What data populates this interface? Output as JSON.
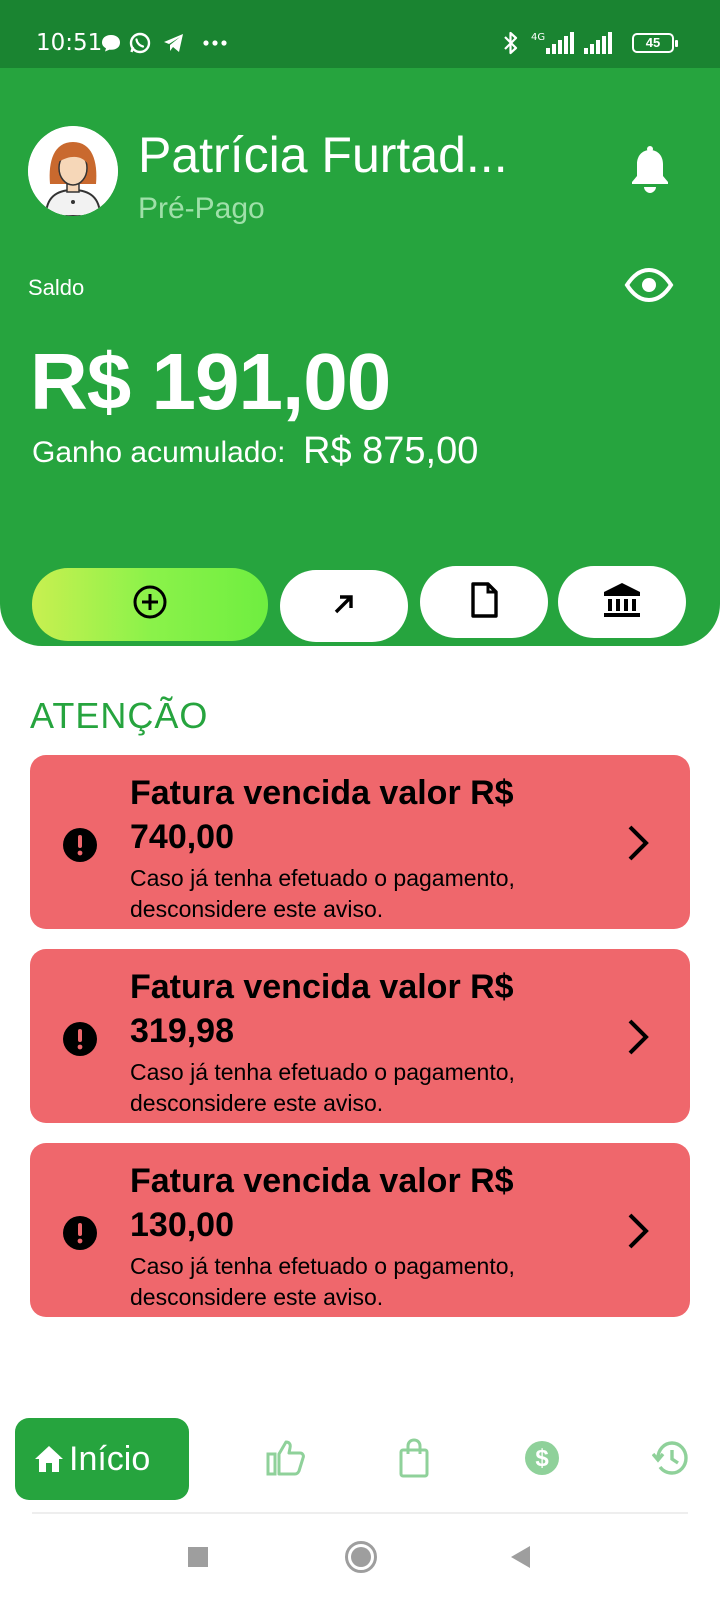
{
  "status_bar": {
    "time": "10:51",
    "network": "4G",
    "battery": "45"
  },
  "profile": {
    "name": "Patrícia Furtad...",
    "plan": "Pré-Pago"
  },
  "balance": {
    "label": "Saldo",
    "value": "R$ 191,00",
    "accumulated_label": "Ganho acumulado:",
    "accumulated_value": "R$ 875,00"
  },
  "actions": [
    {
      "label": "Depositar",
      "icon": "plus-circle-icon"
    },
    {
      "label": "Sacar",
      "icon": "arrow-up-right-icon"
    },
    {
      "label": "Extrato",
      "icon": "document-icon"
    },
    {
      "label": "Banco",
      "icon": "bank-icon"
    }
  ],
  "attention": {
    "title": "ATENÇÃO",
    "alerts": [
      {
        "title": "Fatura vencida valor R$ 740,00",
        "message": "Caso já tenha efetuado o pagamento, desconsidere este aviso."
      },
      {
        "title": "Fatura vencida valor R$ 319,98",
        "message": "Caso já tenha efetuado o pagamento, desconsidere este aviso."
      },
      {
        "title": "Fatura vencida valor R$ 130,00",
        "message": "Caso já tenha efetuado o pagamento, desconsidere este aviso."
      }
    ]
  },
  "bottom_nav": {
    "home_label": "Início",
    "items": [
      "home-icon",
      "thumbs-up-icon",
      "shopping-bag-icon",
      "dollar-circle-icon",
      "history-icon"
    ]
  },
  "colors": {
    "primary_green": "#26a43e",
    "status_bar_green": "#1a8431",
    "alert_red": "#ef676c",
    "plan_text": "#9fe0a9",
    "nav_icon_inactive": "#8fd19a"
  }
}
